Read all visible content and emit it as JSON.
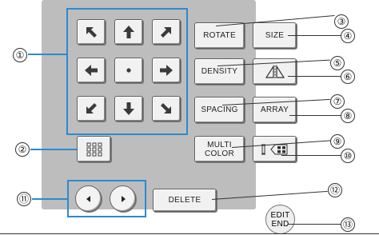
{
  "buttons": {
    "rotate": "ROTATE",
    "size": "SIZE",
    "density": "DENSITY",
    "spacing": "SPACING",
    "array": "ARRAY",
    "multi_color_1": "MULTI",
    "multi_color_2": "COLOR",
    "delete": "DELETE",
    "edit_end_1": "EDIT",
    "edit_end_2": "END"
  },
  "callouts": [
    "①",
    "②",
    "③",
    "④",
    "⑤",
    "⑥",
    "⑦",
    "⑧",
    "⑨",
    "⑩",
    "⑪",
    "⑫",
    "⑬"
  ],
  "icons": {
    "arrows": [
      "arrow-up-left-icon",
      "arrow-up-icon",
      "arrow-up-right-icon",
      "arrow-left-icon",
      "center-dot-icon",
      "arrow-right-icon",
      "arrow-down-left-icon",
      "arrow-down-icon",
      "arrow-down-right-icon"
    ],
    "grid": "grid-icon",
    "mirror": "mirror-icon",
    "pattern_select": "pattern-select-icon",
    "prev": "prev-icon",
    "next": "next-icon"
  },
  "colors": {
    "panel": "#bdbdbd",
    "button": "#f1f1f1",
    "callout_line": "#2a8bd0"
  }
}
